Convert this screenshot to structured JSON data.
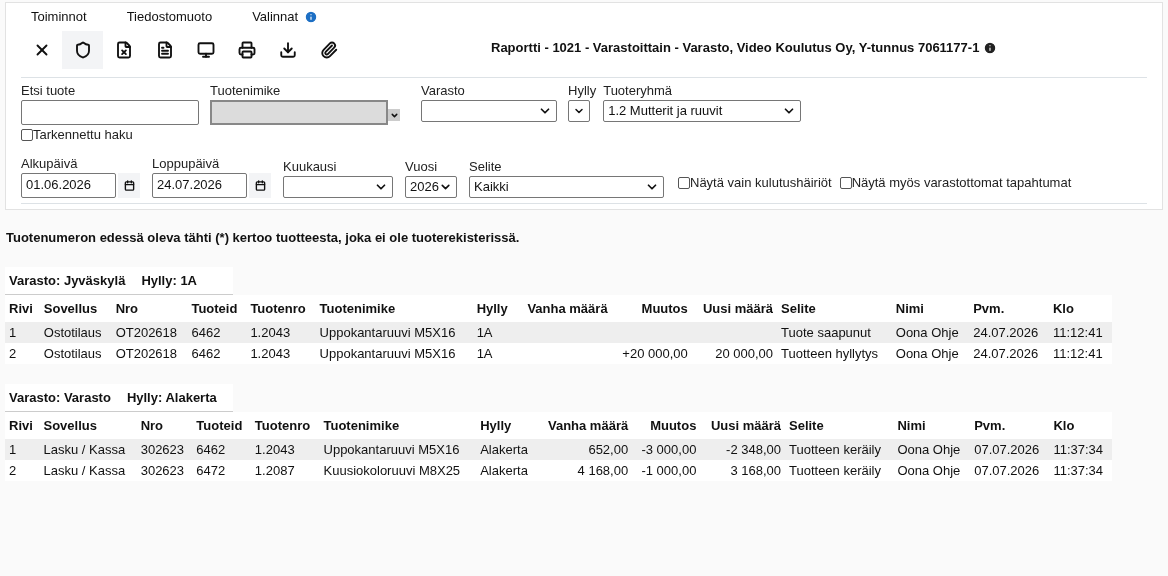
{
  "menu": [
    {
      "label": "Toiminnot",
      "info": false
    },
    {
      "label": "Tiedostomuoto",
      "info": false
    },
    {
      "label": "Valinnat",
      "info": true
    }
  ],
  "toolbar": [
    {
      "kind": "close",
      "selected": false
    },
    {
      "kind": "html",
      "selected": true
    },
    {
      "kind": "excel",
      "selected": false
    },
    {
      "kind": "pdf",
      "selected": false
    },
    {
      "kind": "screen",
      "selected": false
    },
    {
      "kind": "print",
      "selected": false
    },
    {
      "kind": "download",
      "selected": false
    },
    {
      "kind": "attach",
      "selected": false
    }
  ],
  "report_title": "Raportti - 1021 - Varastoittain - Varasto, Video Koulutus Oy, Y-tunnus 7061177-1",
  "filters_row1": {
    "search": {
      "label": "Etsi tuote"
    },
    "advanced": {
      "label": "Tarkennettu haku",
      "checked": false
    },
    "product_name": {
      "label": "Tuotenimike",
      "disabled": true
    },
    "warehouse": {
      "label": "Varasto"
    },
    "shelf": {
      "label": "Hylly"
    },
    "product_group": {
      "label": "Tuoteryhmä",
      "value": "1.2 Mutterit ja ruuvit"
    }
  },
  "filters_row2": {
    "start": {
      "label": "Alkupäivä",
      "value": "01.06.2026"
    },
    "end": {
      "label": "Loppupäivä",
      "value": "24.07.2026"
    },
    "month": {
      "label": "Kuukausi"
    },
    "year": {
      "label": "Vuosi",
      "value": "2026"
    },
    "reason": {
      "label": "Selite",
      "value": "Kaikki"
    },
    "checkboxes": [
      {
        "label": "Näytä vain kulutushäiriöt",
        "checked": false
      },
      {
        "label": "Näytä myös varastottomat tapahtumat",
        "checked": false
      }
    ]
  },
  "note": "Tuotenumeron edessä oleva tähti (*) kertoo tuotteesta, joka ei ole tuoterekisterissä.",
  "groups": [
    {
      "warehouse": "Varasto: Jyväskylä",
      "shelf": "Hylly: 1A",
      "columns": [
        {
          "label": "Rivi",
          "numeric": false
        },
        {
          "label": "Sovellus",
          "numeric": false
        },
        {
          "label": "Nro",
          "numeric": false
        },
        {
          "label": "Tuoteid",
          "numeric": false
        },
        {
          "label": "Tuotenro",
          "numeric": false
        },
        {
          "label": "Tuotenimike",
          "numeric": false
        },
        {
          "label": "Hylly",
          "numeric": false
        },
        {
          "label": "Vanha määrä",
          "numeric": true
        },
        {
          "label": "Muutos",
          "numeric": true
        },
        {
          "label": "Uusi määrä",
          "numeric": true
        },
        {
          "label": "Selite",
          "numeric": false
        },
        {
          "label": "Nimi",
          "numeric": false
        },
        {
          "label": "Pvm.",
          "numeric": false
        },
        {
          "label": "Klo",
          "numeric": false
        }
      ],
      "rows": [
        [
          "1",
          "Ostotilaus",
          "OT202618",
          "6462",
          "1.2043",
          "Uppokantaruuvi M5X16",
          "1A",
          "",
          "",
          "",
          "Tuote saapunut",
          "Oona Ohje",
          "24.07.2026",
          "11:12:41"
        ],
        [
          "2",
          "Ostotilaus",
          "OT202618",
          "6462",
          "1.2043",
          "Uppokantaruuvi M5X16",
          "1A",
          "",
          "+20 000,00",
          "20 000,00",
          "Tuotteen hyllytys",
          "Oona Ohje",
          "24.07.2026",
          "11:12:41"
        ]
      ]
    },
    {
      "warehouse": "Varasto: Varasto",
      "shelf": "Hylly: Alakerta",
      "columns": [
        {
          "label": "Rivi",
          "numeric": false
        },
        {
          "label": "Sovellus",
          "numeric": false
        },
        {
          "label": "Nro",
          "numeric": false
        },
        {
          "label": "Tuoteid",
          "numeric": false
        },
        {
          "label": "Tuotenro",
          "numeric": false
        },
        {
          "label": "Tuotenimike",
          "numeric": false
        },
        {
          "label": "Hylly",
          "numeric": false
        },
        {
          "label": "Vanha määrä",
          "numeric": true
        },
        {
          "label": "Muutos",
          "numeric": true
        },
        {
          "label": "Uusi määrä",
          "numeric": true
        },
        {
          "label": "Selite",
          "numeric": false
        },
        {
          "label": "Nimi",
          "numeric": false
        },
        {
          "label": "Pvm.",
          "numeric": false
        },
        {
          "label": "Klo",
          "numeric": false
        }
      ],
      "rows": [
        [
          "1",
          "Lasku / Kassa",
          "302623",
          "6462",
          "1.2043",
          "Uppokantaruuvi M5X16",
          "Alakerta",
          "652,00",
          "-3 000,00",
          "-2 348,00",
          "Tuotteen keräily",
          "Oona Ohje",
          "07.07.2026",
          "11:37:34"
        ],
        [
          "2",
          "Lasku / Kassa",
          "302623",
          "6472",
          "1.2087",
          "Kuusiokoloruuvi M8X25",
          "Alakerta",
          "4 168,00",
          "-1 000,00",
          "3 168,00",
          "Tuotteen keräily",
          "Oona Ohje",
          "07.07.2026",
          "11:37:34"
        ]
      ]
    }
  ]
}
